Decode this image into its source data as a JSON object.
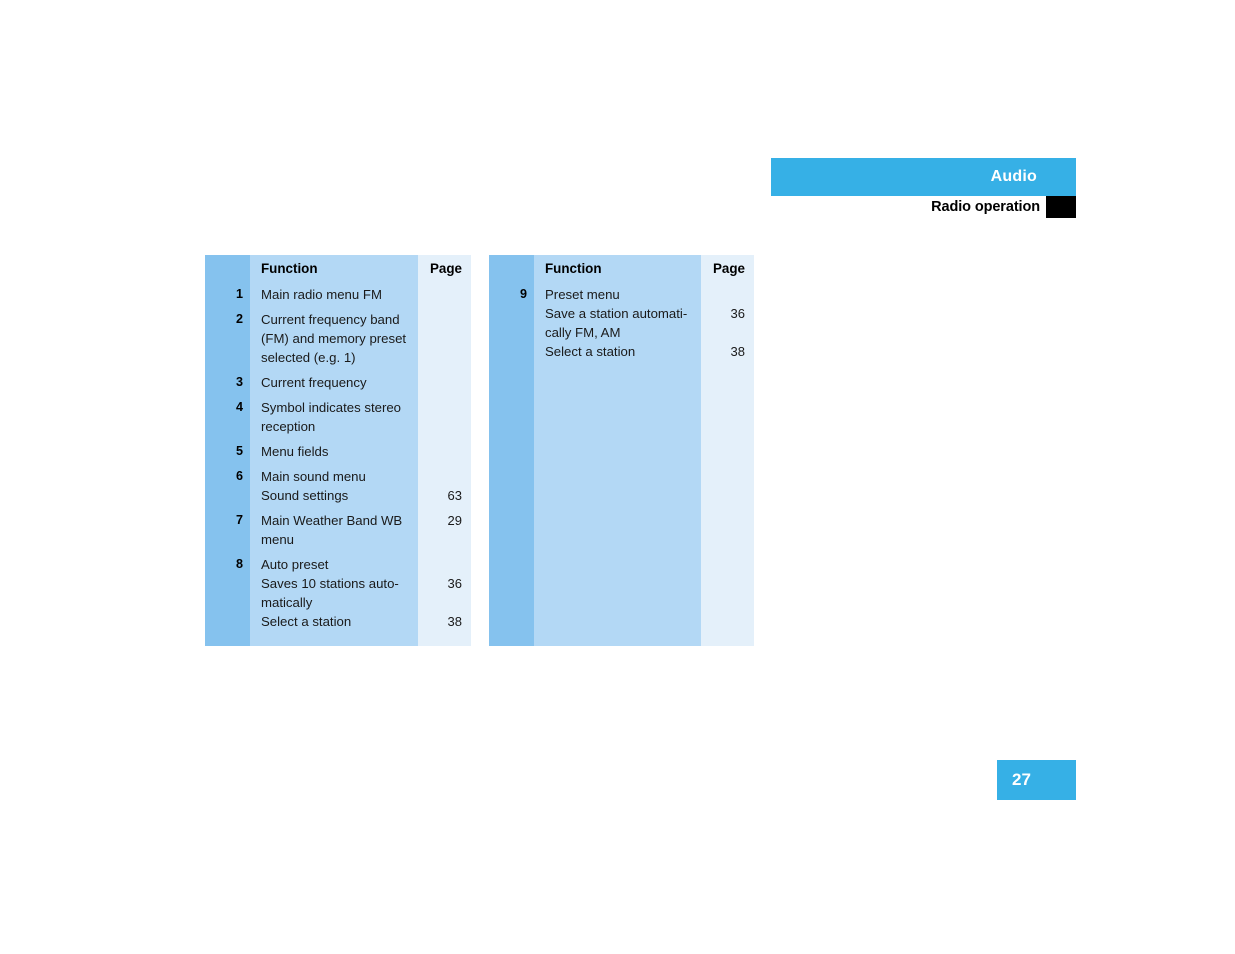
{
  "header": {
    "banner_title": "Audio",
    "subtitle": "Radio operation",
    "banner_color": "#36b0e6",
    "chapter_tab_color": "#000000"
  },
  "footer": {
    "page_number": "27",
    "box_color": "#36b0e6"
  },
  "colors": {
    "index_column": "#85c2ee",
    "function_column": "#b3d8f5",
    "page_column": "#e4f0fa"
  },
  "tables": [
    {
      "id": "left",
      "headers": {
        "function": "Function",
        "page": "Page"
      },
      "rows": [
        {
          "index": "1",
          "lines": [
            "Main radio menu FM"
          ],
          "pages": [
            ""
          ]
        },
        {
          "index": "2",
          "lines": [
            "Current frequency band",
            "(FM) and memory preset",
            "selected (e.g. 1)"
          ],
          "pages": [
            "",
            "",
            ""
          ]
        },
        {
          "index": "3",
          "lines": [
            "Current frequency"
          ],
          "pages": [
            ""
          ]
        },
        {
          "index": "4",
          "lines": [
            "Symbol indicates stereo",
            "reception"
          ],
          "pages": [
            "",
            ""
          ]
        },
        {
          "index": "5",
          "lines": [
            "Menu fields"
          ],
          "pages": [
            ""
          ]
        },
        {
          "index": "6",
          "lines": [
            "Main sound menu",
            "Sound settings"
          ],
          "pages": [
            "",
            "63"
          ]
        },
        {
          "index": "7",
          "lines": [
            "Main Weather Band WB",
            "menu"
          ],
          "pages": [
            "29",
            ""
          ]
        },
        {
          "index": "8",
          "lines": [
            "Auto preset",
            "Saves 10 stations auto-",
            "matically",
            "Select a station"
          ],
          "pages": [
            "",
            "36",
            "",
            "38"
          ]
        }
      ]
    },
    {
      "id": "right",
      "headers": {
        "function": "Function",
        "page": "Page"
      },
      "rows": [
        {
          "index": "9",
          "lines": [
            "Preset menu",
            "Save a station automati-",
            "cally FM, AM",
            "Select a station"
          ],
          "pages": [
            "",
            "36",
            "",
            "38"
          ]
        }
      ]
    }
  ]
}
